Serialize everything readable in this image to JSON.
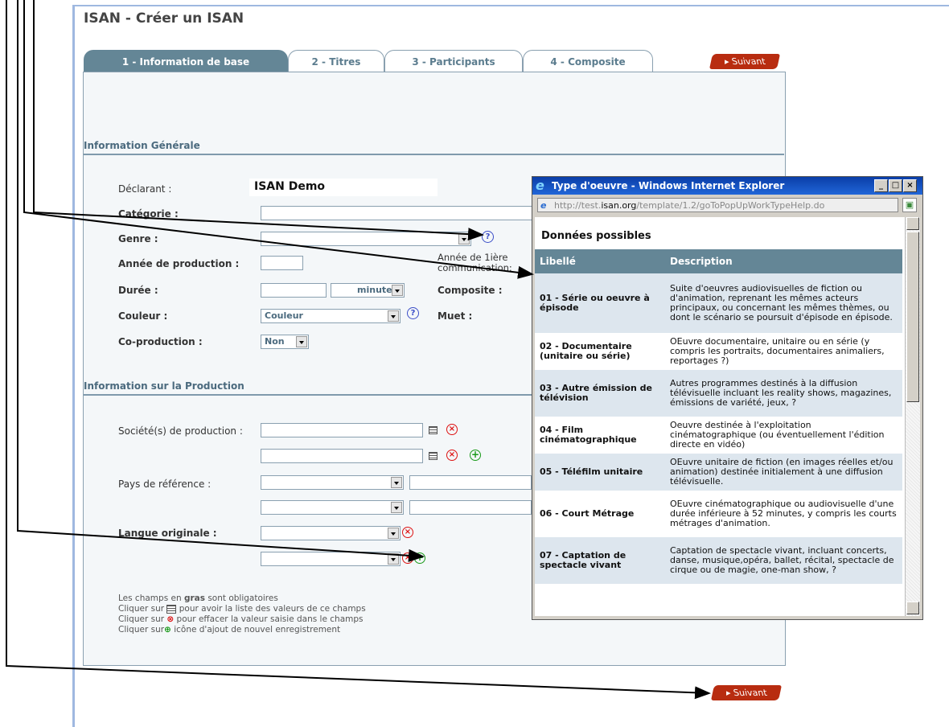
{
  "page": {
    "title": "ISAN - Créer un ISAN"
  },
  "tabs": [
    "1 - Information de base",
    "2 - Titres",
    "3 - Participants",
    "4 - Composite"
  ],
  "next_label": "Suivant",
  "general": {
    "section_title": "Information Générale",
    "declarant_label": "Déclarant :",
    "declarant_value": "ISAN Demo",
    "categorie_label": "Catégorie :",
    "genre_label": "Genre :",
    "annee_label": "Année de production :",
    "annee_1iere_label": "Année de 1ière communication:",
    "duree_label": "Durée :",
    "duree_unit": "minutes",
    "composite_label": "Composite :",
    "couleur_label": "Couleur :",
    "couleur_value": "Couleur",
    "muet_label": "Muet :",
    "coprod_label": "Co-production :",
    "coprod_value": "Non"
  },
  "production": {
    "section_title": "Information sur la Production",
    "societe_label": "Société(s) de production :",
    "pays_label": "Pays de référence :",
    "langue_label": "Langue originale :"
  },
  "notes": {
    "line1_pre": "Les champs en ",
    "line1_bold": "gras",
    "line1_post": " sont obligatoires",
    "line2_pre": "Cliquer sur",
    "line2_post": "pour avoir la liste des valeurs de ce champs",
    "line3_pre": "Cliquer sur",
    "line3_post": "pour effacer la valeur saisie dans le champs",
    "line4_pre": "Cliquer sur",
    "line4_post": "icône d'ajout de nouvel enregistrement"
  },
  "popup": {
    "title": "Type d'oeuvre - Windows Internet Explorer",
    "url_prefix": "http://test.",
    "url_domain": "isan.org",
    "url_path": "/template/1.2/goToPopUpWorkTypeHelp.do",
    "heading": "Données possibles",
    "col_label": "Libellé",
    "col_desc": "Description",
    "rows": [
      {
        "label": "01 - Série ou oeuvre à épisode",
        "desc": "Suite d'oeuvres audiovisuelles de fiction ou d'animation, reprenant les mêmes acteurs principaux, ou concernant les mêmes thèmes, ou dont le scénario se poursuit d'épisode en épisode."
      },
      {
        "label": "02 - Documentaire (unitaire ou série)",
        "desc": "OEuvre documentaire, unitaire ou en série (y compris les portraits, documentaires animaliers, reportages ?)"
      },
      {
        "label": "03 - Autre émission de télévision",
        "desc": "Autres programmes destinés à la diffusion télévisuelle incluant les reality shows, magazines, émissions de variété, jeux, ?"
      },
      {
        "label": "04 - Film cinématographique",
        "desc": "Oeuvre destinée à l'exploitation cinématographique (ou éventuellement l'édition directe en vidéo)"
      },
      {
        "label": "05 - Téléfilm unitaire",
        "desc": "OEuvre unitaire de fiction (en images réelles et/ou animation) destinée initialement à une diffusion télévisuelle."
      },
      {
        "label": "06 - Court Métrage",
        "desc": "OEuvre cinématographique ou audiovisuelle d'une durée inférieure à 52 minutes, y compris les courts métrages d'animation."
      },
      {
        "label": "07 - Captation de spectacle vivant",
        "desc": "Captation de spectacle vivant, incluant concerts, danse, musique,opéra, ballet, récital, spectacle de cirque ou de magie, one-man show, ?"
      }
    ]
  },
  "colors": {
    "tab_active": "#648696",
    "next_button": "#b82c10",
    "section_text": "#4b6a7e"
  }
}
